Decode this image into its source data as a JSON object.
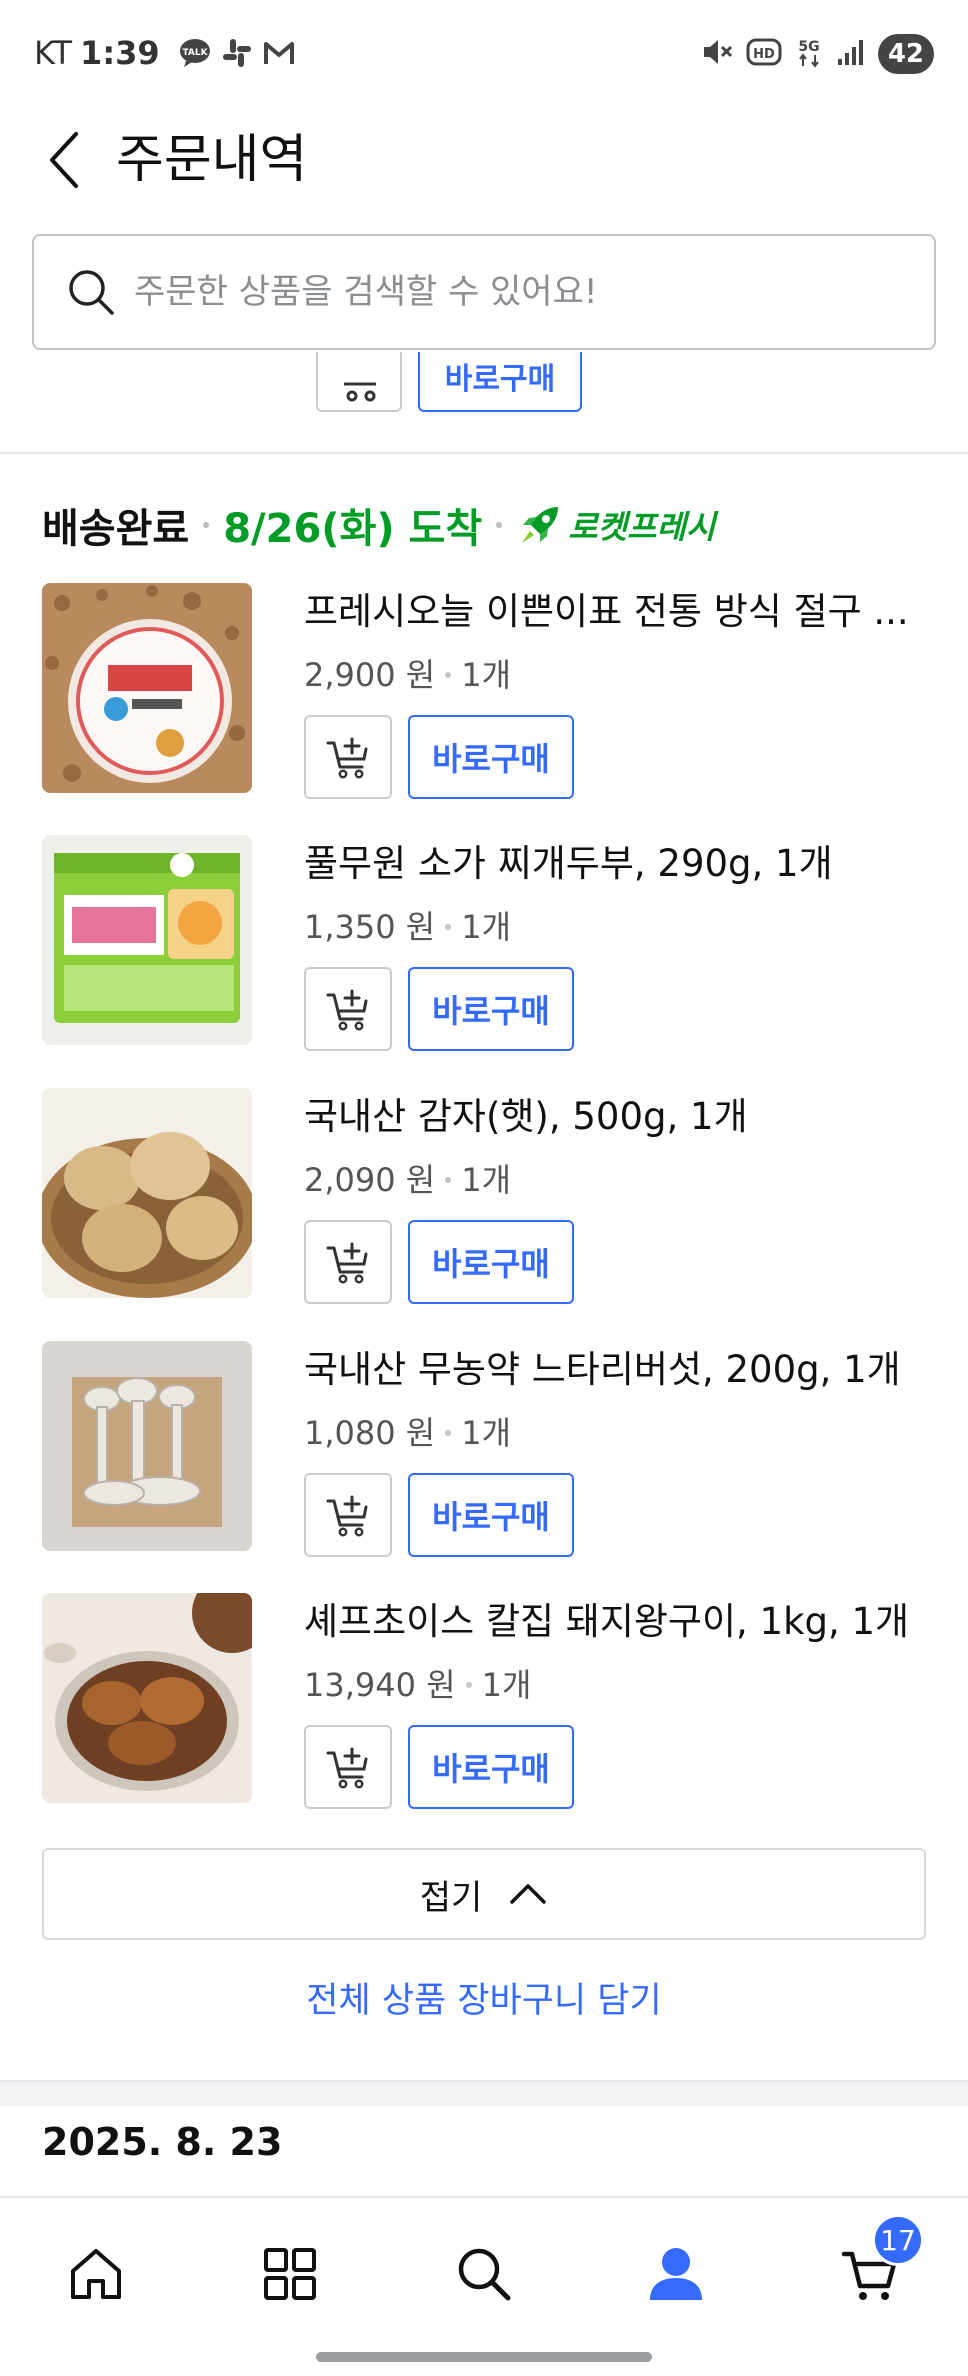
{
  "status_bar": {
    "carrier": "KT",
    "time": "1:39",
    "battery": "42",
    "left_icons": [
      "talk-icon",
      "slack-icon",
      "gmail-icon"
    ],
    "right_icons": [
      "mute-icon",
      "hd-icon",
      "5g-icon",
      "signal-icon"
    ]
  },
  "header": {
    "title": "주문내역"
  },
  "search": {
    "placeholder": "주문한 상품을 검색할 수 있어요!"
  },
  "partial_row": {
    "buy_label": "바로구매"
  },
  "group": {
    "status": "배송완료",
    "arrival": "8/26(화) 도착",
    "badge": "로켓프레시",
    "items": [
      {
        "name": "프레시오늘 이쁜이표 전통 방식 절구 ...",
        "price": "2,900 원",
        "qty": "1개",
        "cart_label": "",
        "buy_label": "바로구매"
      },
      {
        "name": "풀무원 소가 찌개두부, 290g, 1개",
        "price": "1,350 원",
        "qty": "1개",
        "buy_label": "바로구매"
      },
      {
        "name": "국내산 감자(햇), 500g, 1개",
        "price": "2,090 원",
        "qty": "1개",
        "buy_label": "바로구매"
      },
      {
        "name": "국내산 무농약 느타리버섯, 200g, 1개",
        "price": "1,080 원",
        "qty": "1개",
        "buy_label": "바로구매"
      },
      {
        "name": "셰프초이스 칼집 돼지왕구이, 1kg, 1개",
        "price": "13,940 원",
        "qty": "1개",
        "buy_label": "바로구매"
      }
    ],
    "fold_label": "접기",
    "add_all_label": "전체 상품 장바구니 담기"
  },
  "next_group": {
    "date": "2025. 8. 23"
  },
  "bottom_nav": {
    "items": [
      "home-icon",
      "categories-icon",
      "search-icon",
      "my-page-icon",
      "cart-icon"
    ],
    "cart_count": "17"
  },
  "colors": {
    "accent": "#346aff",
    "rocket_green": "#009c25"
  }
}
